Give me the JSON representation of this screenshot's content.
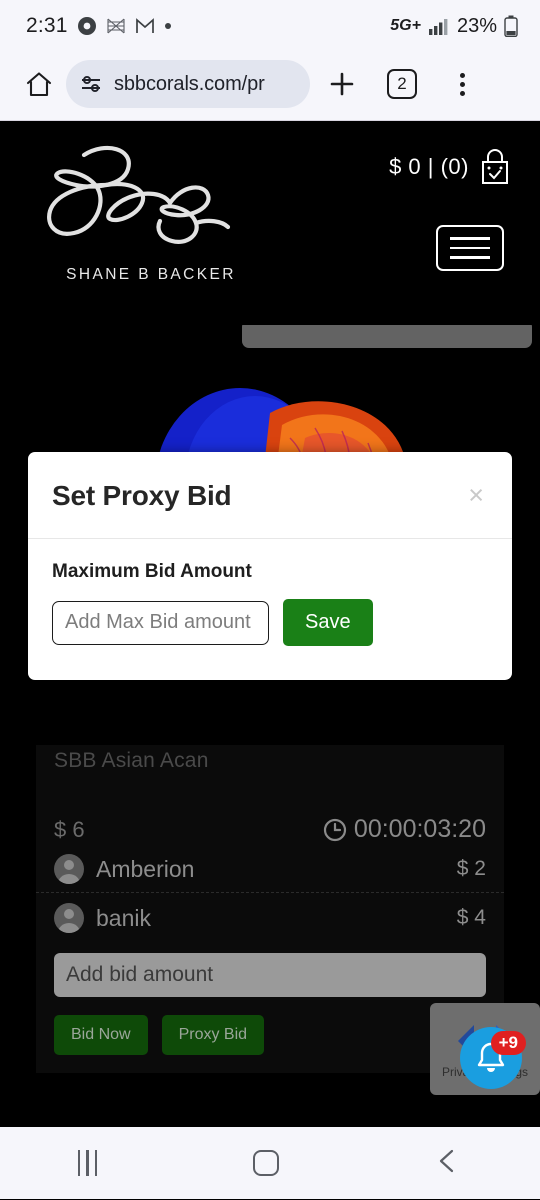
{
  "status_bar": {
    "time": "2:31",
    "icons": [
      "chrome-icon",
      "nyt-icon",
      "gmail-icon",
      "dot-icon"
    ],
    "network": "5G+",
    "battery_percent": "23%"
  },
  "browser": {
    "url": "sbbcorals.com/pr",
    "tab_count": "2",
    "home_icon": "home-icon",
    "site_info_icon": "page-info-icon",
    "new_tab_icon": "plus-icon",
    "menu_icon": "overflow-menu-icon"
  },
  "site_header": {
    "brand_name": "SHANE B BACKER",
    "cart_text": "$ 0 | (0)",
    "cart_icon": "shopping-bag-icon",
    "menu_icon": "hamburger-menu-icon"
  },
  "listing": {
    "title": "SBB Asian Acan",
    "current_price": "$ 6",
    "timer": "00:00:03:20",
    "timer_icon": "clock-icon",
    "bids": [
      {
        "name": "Amberion",
        "amount": "$ 2"
      },
      {
        "name": "banik",
        "amount": "$ 4"
      }
    ],
    "bid_input_placeholder": "Add bid amount",
    "bid_now_label": "Bid Now",
    "proxy_bid_label": "Proxy Bid"
  },
  "modal": {
    "title": "Set Proxy Bid",
    "close_label": "×",
    "field_label": "Maximum Bid Amount",
    "input_placeholder": "Add Max Bid amount",
    "input_value": "",
    "save_label": "Save"
  },
  "privacy_widget": {
    "label": "Privacy Settings",
    "badge": "+9",
    "bell_icon": "bell-icon"
  },
  "nav_bar": {
    "recents_icon": "recents-icon",
    "home_icon": "home-square-icon",
    "back_icon": "back-chevron-icon"
  },
  "colors": {
    "accent_green": "#1a8017",
    "dark_green": "#0e4a08",
    "fab_blue": "#1a9ee0",
    "badge_red": "#e02020",
    "page_black": "#000000",
    "chrome_bg": "#f6f6fb"
  }
}
